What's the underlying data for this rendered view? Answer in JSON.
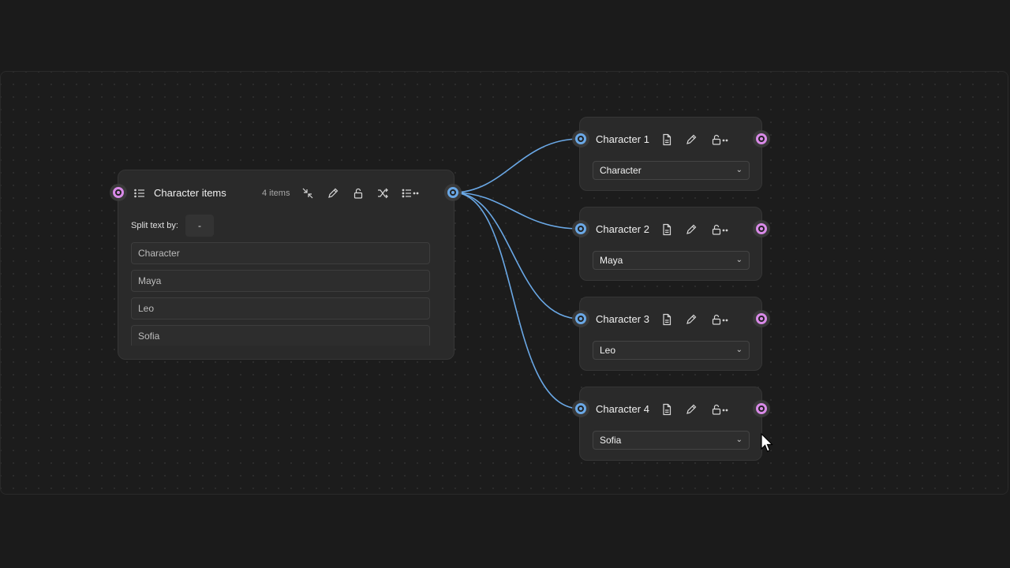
{
  "main_node": {
    "title": "Character items",
    "count_label": "4 items",
    "split_label": "Split text by:",
    "split_value": "-",
    "items": [
      "Character",
      "Maya",
      "Leo",
      "Sofia"
    ]
  },
  "character_nodes": [
    {
      "title": "Character 1",
      "selected": "Character"
    },
    {
      "title": "Character 2",
      "selected": "Maya"
    },
    {
      "title": "Character 3",
      "selected": "Leo"
    },
    {
      "title": "Character 4",
      "selected": "Sofia"
    }
  ],
  "icons": {
    "list": "list-icon",
    "collapse": "collapse-icon",
    "edit": "pencil-icon",
    "lock": "unlock-icon",
    "shuffle": "shuffle-icon",
    "more": "list-more-icon",
    "document": "document-icon",
    "chevron": "⌄"
  },
  "colors": {
    "input_port": "#d98ae8",
    "output_port": "#6aa8e6",
    "wire": "#6aa8e6",
    "node_bg": "#2a2a2a",
    "canvas_bg": "#1c1c1c"
  }
}
